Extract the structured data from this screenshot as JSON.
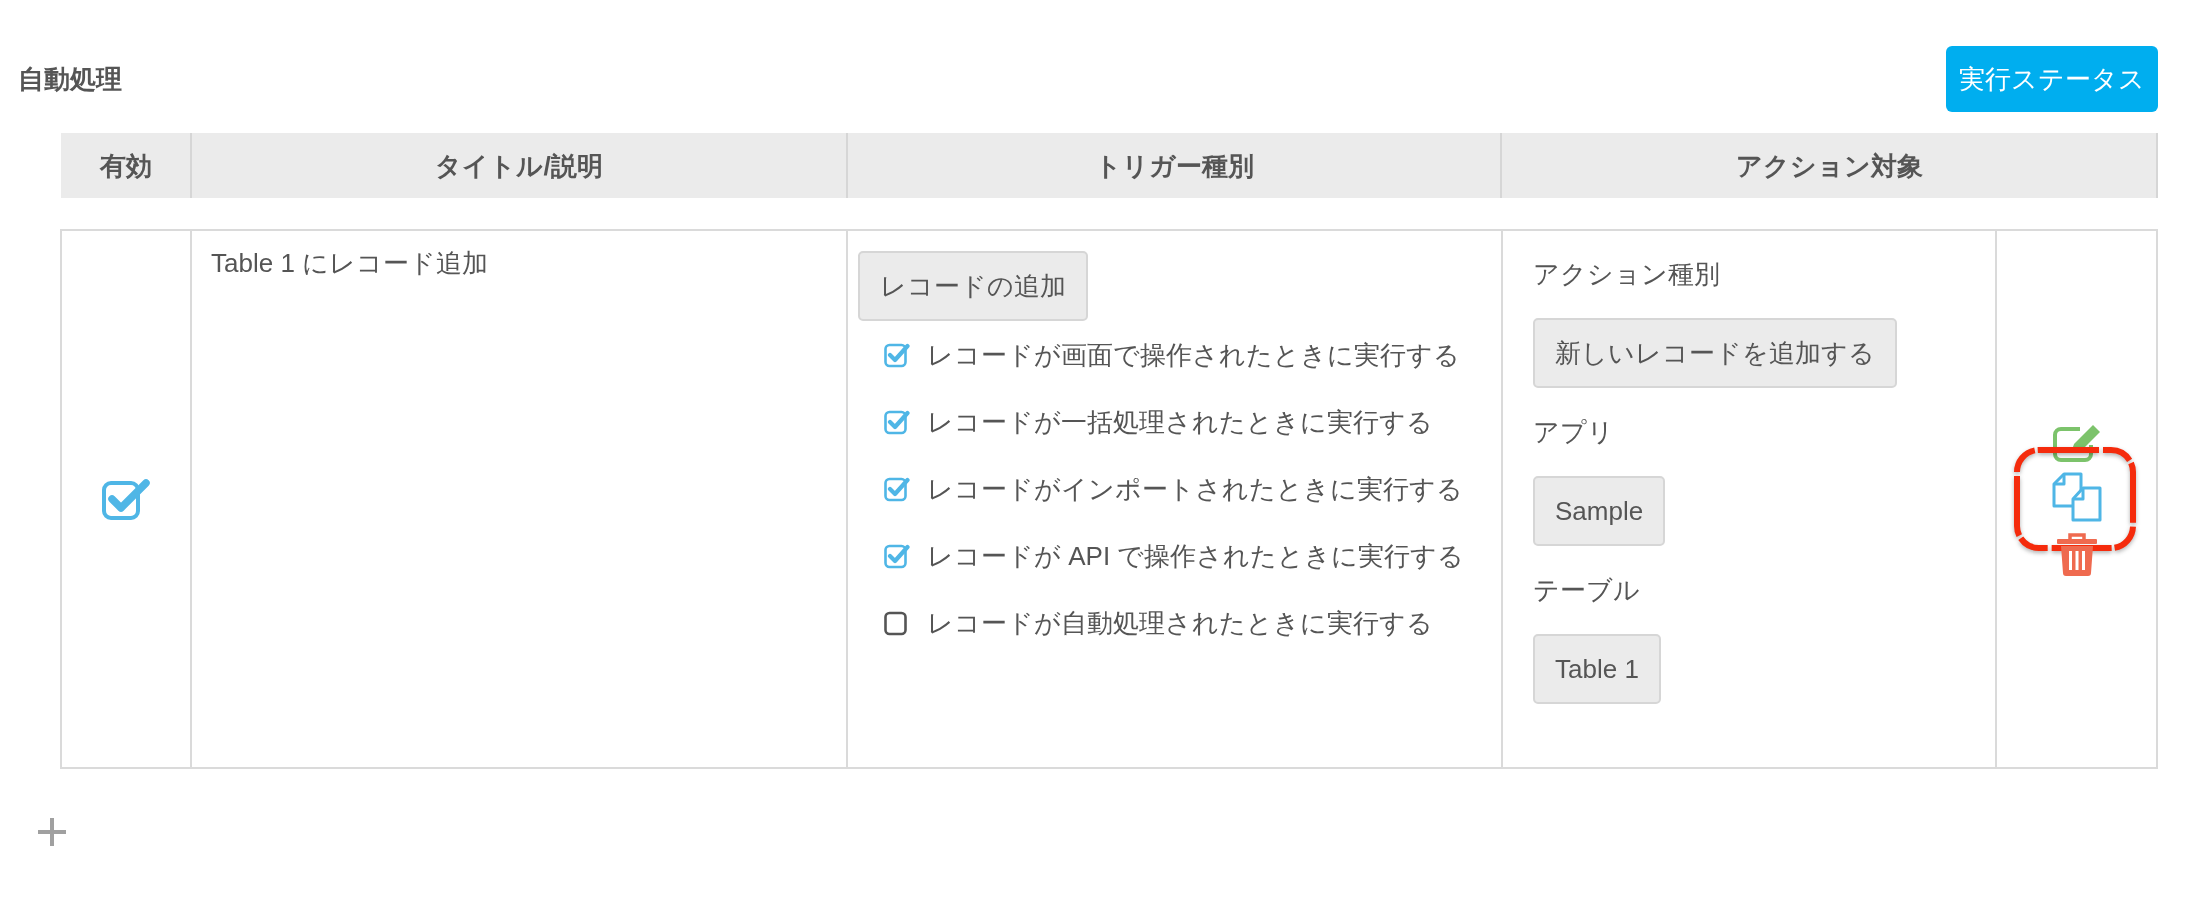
{
  "section": {
    "title": "自動処理",
    "status_button": "実行ステータス"
  },
  "table": {
    "columns": [
      "有効",
      "タイトル/説明",
      "トリガー種別",
      "アクション対象"
    ],
    "rows": [
      {
        "enabled": true,
        "title": "Table 1 にレコード追加",
        "trigger": {
          "type": "レコードの追加",
          "options": [
            {
              "label": "レコードが画面で操作されたときに実行する",
              "checked": true
            },
            {
              "label": "レコードが一括処理されたときに実行する",
              "checked": true
            },
            {
              "label": "レコードがインポートされたときに実行する",
              "checked": true
            },
            {
              "label": "レコードが API で操作されたときに実行する",
              "checked": true
            },
            {
              "label": "レコードが自動処理されたときに実行する",
              "checked": false
            }
          ]
        },
        "action": [
          {
            "label": "アクション種別",
            "value": "新しいレコードを追加する"
          },
          {
            "label": "アプリ",
            "value": "Sample"
          },
          {
            "label": "テーブル",
            "value": "Table 1"
          }
        ],
        "tools": [
          {
            "kind": "edit",
            "highlighted": false
          },
          {
            "kind": "copy",
            "highlighted": true
          },
          {
            "kind": "delete",
            "highlighted": false
          }
        ]
      }
    ]
  }
}
